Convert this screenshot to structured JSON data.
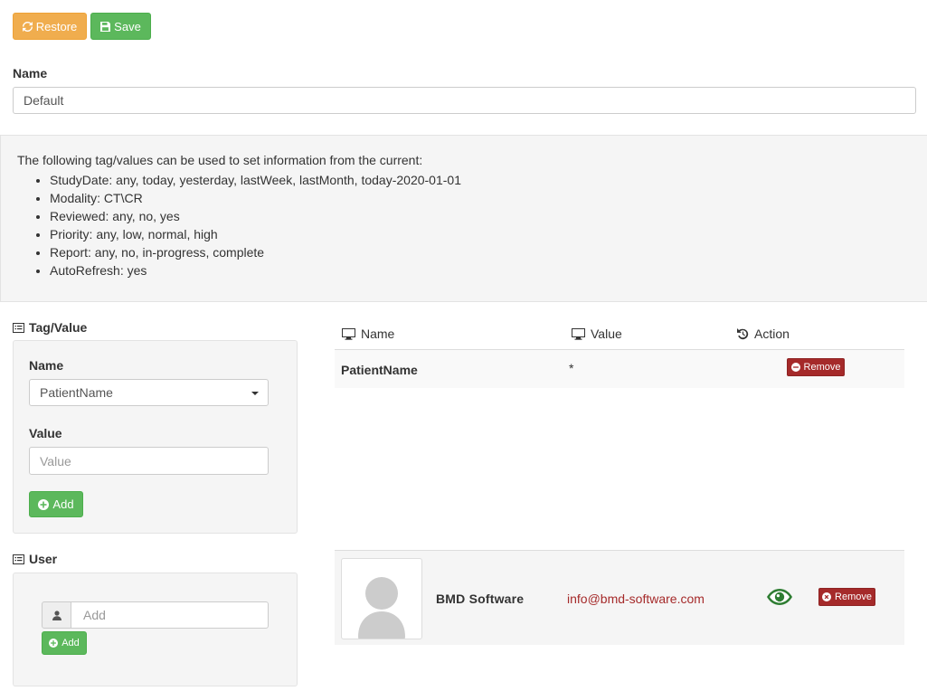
{
  "toolbar": {
    "restore_label": "Restore",
    "save_label": "Save"
  },
  "profile": {
    "name_label": "Name",
    "name_value": "Default"
  },
  "info": {
    "intro": "The following tag/values can be used to set information from the current:",
    "items": [
      "StudyDate: any, today, yesterday, lastWeek, lastMonth, today-2020-01-01",
      "Modality: CT\\CR",
      "Reviewed: any, no, yes",
      "Priority: any, low, normal, high",
      "Report: any, no, in-progress, complete",
      "AutoRefresh: yes"
    ]
  },
  "tag_value": {
    "title": "Tag/Value",
    "name_label": "Name",
    "name_selected": "PatientName",
    "value_label": "Value",
    "value_placeholder": "Value",
    "add_label": "Add"
  },
  "table": {
    "headers": {
      "name": "Name",
      "value": "Value",
      "action": "Action"
    },
    "rows": [
      {
        "name": "PatientName",
        "value": "*",
        "action_label": "Remove"
      }
    ]
  },
  "user_section": {
    "title": "User",
    "input_placeholder": "Add",
    "add_label": "Add"
  },
  "users": [
    {
      "name": "BMD Software",
      "email": "info@bmd-software.com",
      "remove_label": "Remove"
    }
  ],
  "colors": {
    "warning": "#f0ad4e",
    "success": "#5cb85c",
    "danger": "#a52a2a",
    "eye": "#2e7d32",
    "email": "#a52a2a"
  }
}
